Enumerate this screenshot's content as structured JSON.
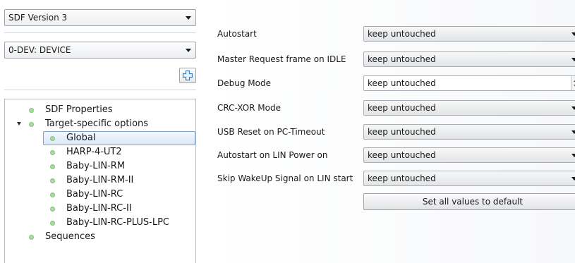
{
  "left": {
    "sdf_version": {
      "value": "SDF Version 3"
    },
    "device": {
      "value": "0-DEV: DEVICE"
    },
    "tree": {
      "items": [
        {
          "label": "SDF Properties"
        },
        {
          "label": "Target-specific options"
        },
        {
          "label": "Global"
        },
        {
          "label": "HARP-4-UT2"
        },
        {
          "label": "Baby-LIN-RM"
        },
        {
          "label": "Baby-LIN-RM-II"
        },
        {
          "label": "Baby-LIN-RC"
        },
        {
          "label": "Baby-LIN-RC-II"
        },
        {
          "label": "Baby-LIN-RC-PLUS-LPC"
        },
        {
          "label": "Sequences"
        }
      ]
    }
  },
  "options": {
    "autostart": {
      "label": "Autostart",
      "value": "keep untouched"
    },
    "master_request": {
      "label": "Master Request frame on IDLE",
      "value": "keep untouched"
    },
    "debug_mode": {
      "label": "Debug Mode",
      "value": "keep untouched"
    },
    "crc_xor": {
      "label": "CRC-XOR Mode",
      "value": "keep untouched"
    },
    "usb_reset": {
      "label": "USB Reset on PC-Timeout",
      "value": "keep untouched"
    },
    "autostart_lin": {
      "label": "Autostart on LIN Power on",
      "value": "keep untouched"
    },
    "skip_wakeup": {
      "label": "Skip WakeUp Signal on LIN start",
      "value": "keep untouched"
    }
  },
  "buttons": {
    "set_default": "Set all values to default"
  },
  "icons": {
    "add": "add-icon",
    "bullet": "bullet-dot-icon",
    "expand": "expand-arrow-icon"
  },
  "colors": {
    "bullet": "#8fcf8a",
    "selection_border": "#7da2ce",
    "add_icon": "#3b82c4"
  }
}
